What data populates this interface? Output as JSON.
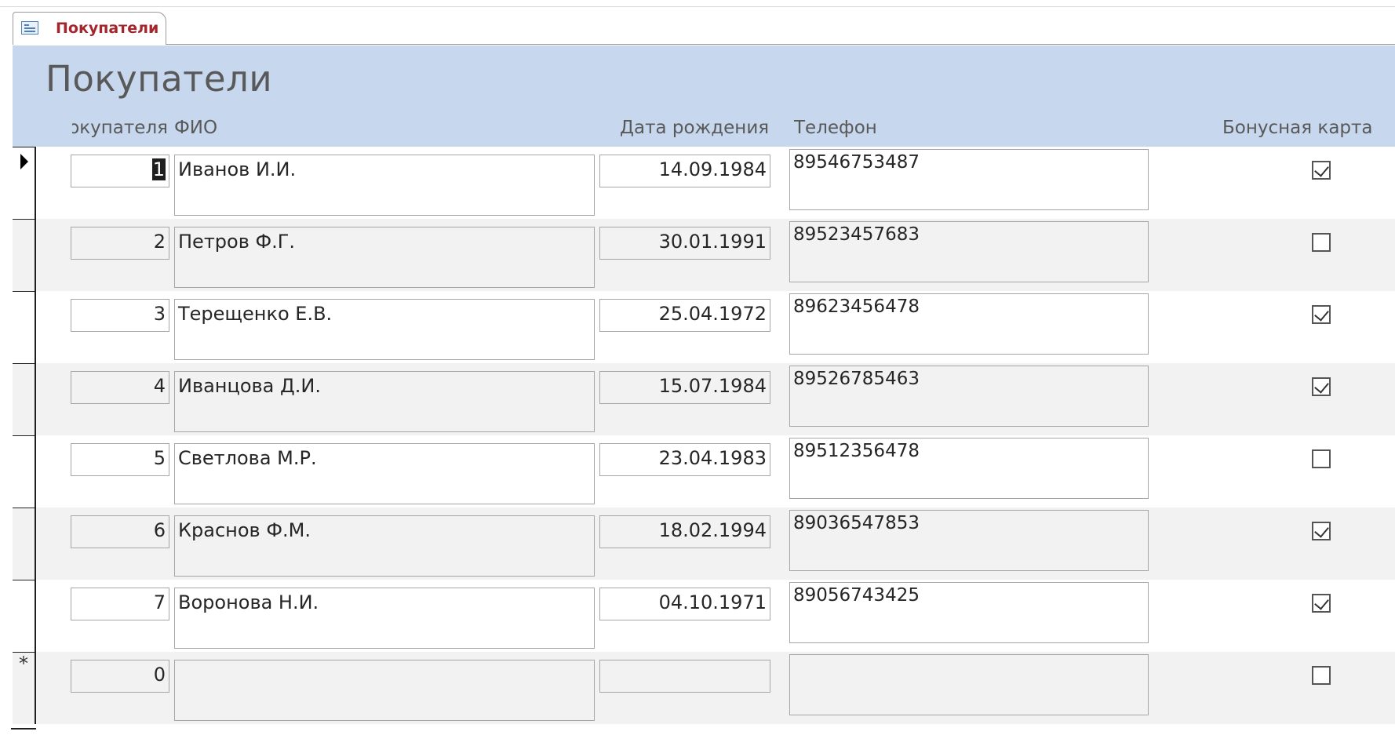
{
  "tab": {
    "label": "Покупатели",
    "icon": "form-icon"
  },
  "form": {
    "title": "Покупатели"
  },
  "columns": {
    "id": "Код покупателя",
    "fio": "ФИО",
    "dob": "Дата рождения",
    "phone": "Телефон",
    "bonus": "Бонусная карта"
  },
  "rows": [
    {
      "id": "1",
      "fio": "Иванов И.И.",
      "dob": "14.09.1984",
      "phone": "89546753487",
      "bonus": true
    },
    {
      "id": "2",
      "fio": "Петров Ф.Г.",
      "dob": "30.01.1991",
      "phone": "89523457683",
      "bonus": false
    },
    {
      "id": "3",
      "fio": "Терещенко Е.В.",
      "dob": "25.04.1972",
      "phone": "89623456478",
      "bonus": true
    },
    {
      "id": "4",
      "fio": "Иванцова Д.И.",
      "dob": "15.07.1984",
      "phone": "89526785463",
      "bonus": true
    },
    {
      "id": "5",
      "fio": "Светлова М.Р.",
      "dob": "23.04.1983",
      "phone": "89512356478",
      "bonus": false
    },
    {
      "id": "6",
      "fio": "Краснов Ф.М.",
      "dob": "18.02.1994",
      "phone": "89036547853",
      "bonus": true
    },
    {
      "id": "7",
      "fio": "Воронова Н.И.",
      "dob": "04.10.1971",
      "phone": "89056743425",
      "bonus": true
    }
  ],
  "new_row": {
    "id": "0",
    "fio": "",
    "dob": "",
    "phone": "",
    "bonus": false,
    "marker": "*"
  }
}
